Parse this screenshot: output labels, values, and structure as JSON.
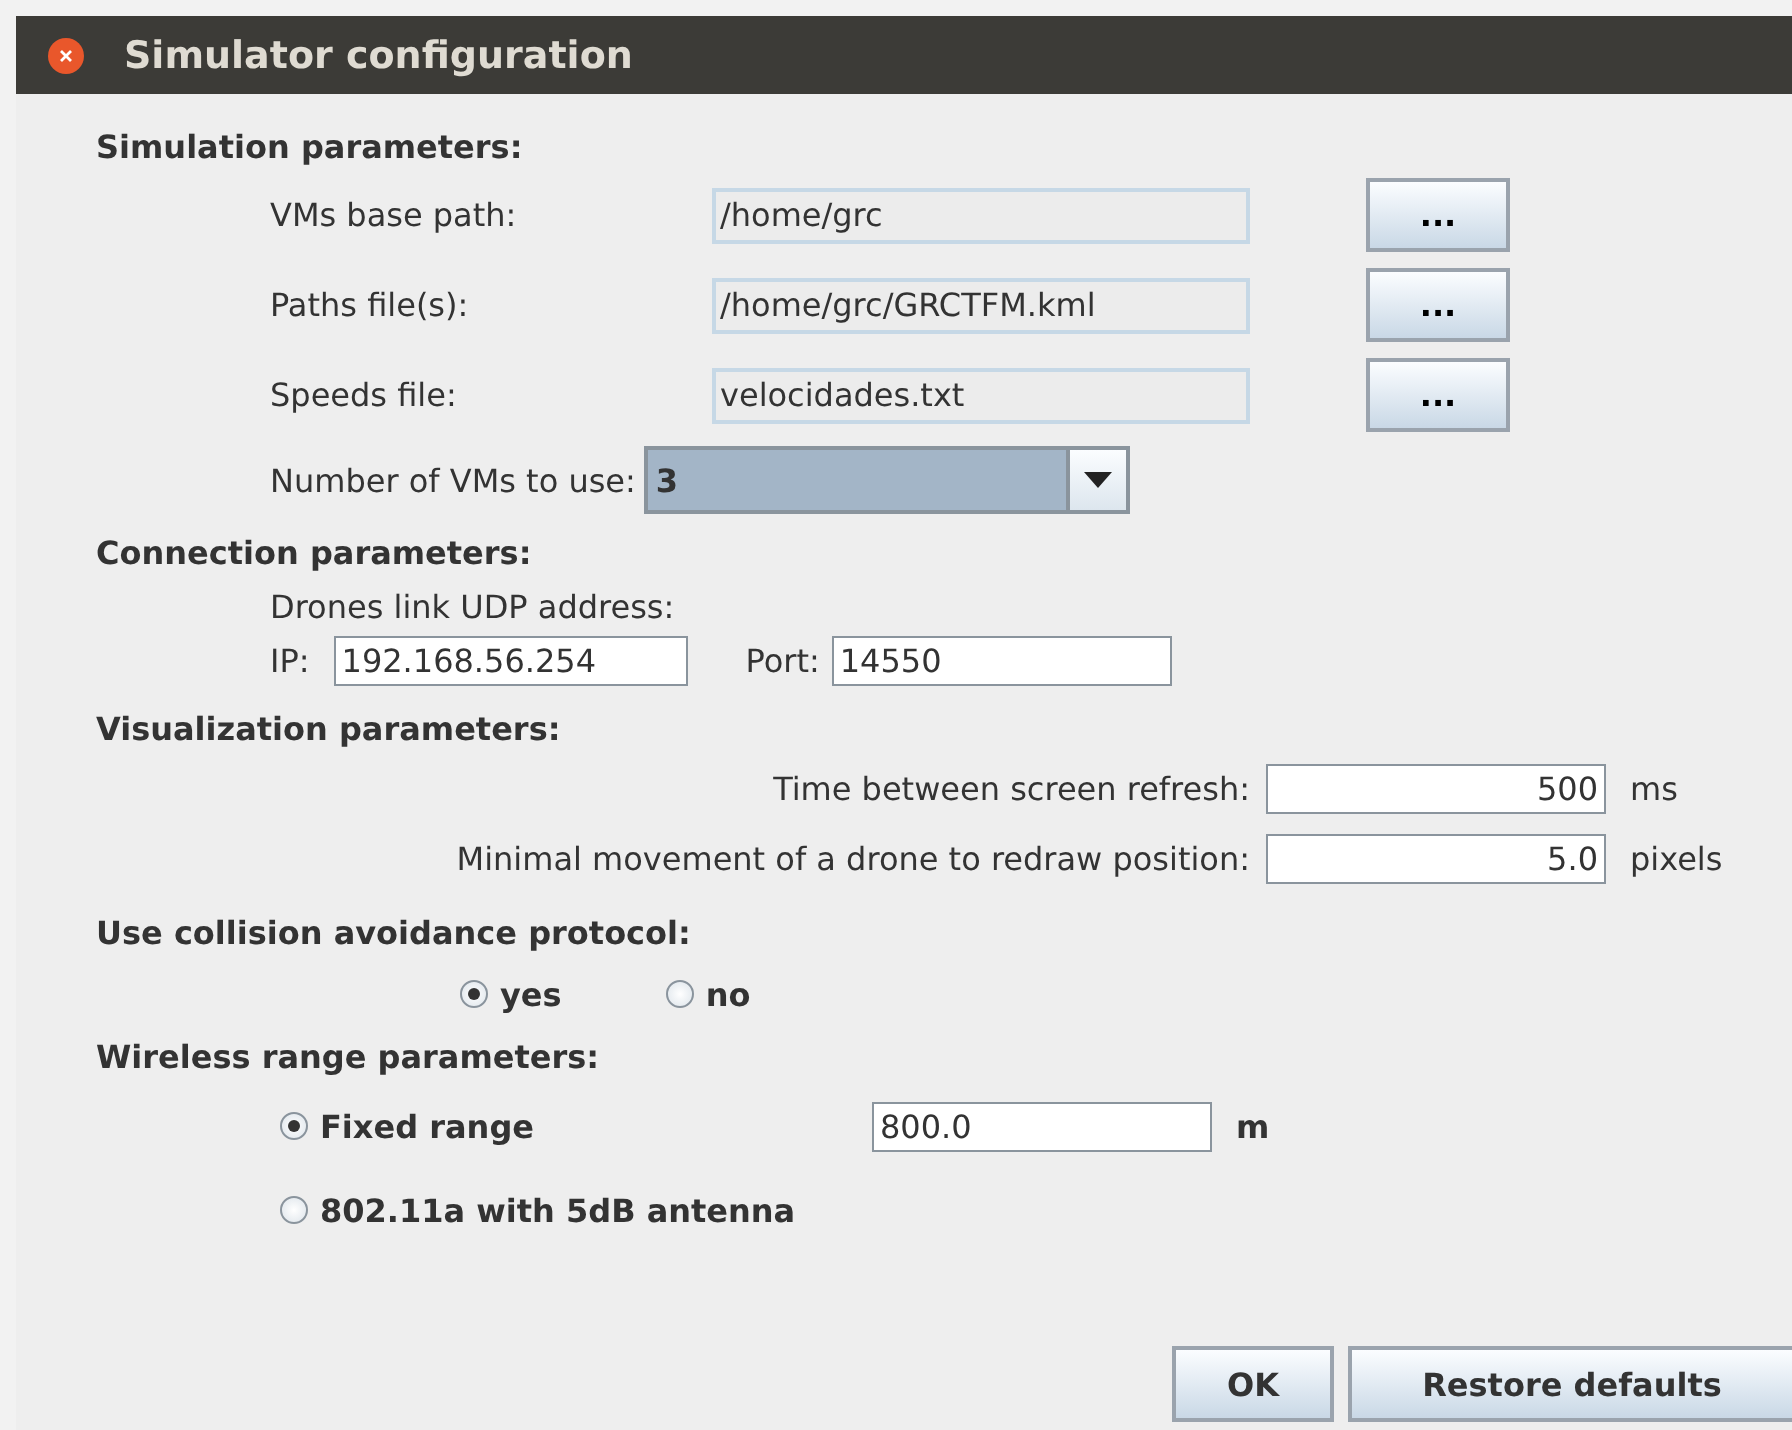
{
  "window": {
    "title": "Simulator configuration"
  },
  "simulation": {
    "heading": "Simulation parameters:",
    "files": [
      {
        "label": "VMs base path:",
        "value": "/home/grc",
        "button": "..."
      },
      {
        "label": "Paths file(s):",
        "value": "/home/grc/GRCTFM.kml",
        "button": "..."
      },
      {
        "label": "Speeds file:",
        "value": "velocidades.txt",
        "button": "..."
      }
    ],
    "vms": {
      "label": "Number of VMs to use:",
      "value": "3"
    }
  },
  "connection": {
    "heading": "Connection parameters:",
    "subheading": "Drones link UDP address:",
    "ip_label": "IP:",
    "ip": "192.168.56.254",
    "port_label": "Port:",
    "port": "14550"
  },
  "visualization": {
    "heading": "Visualization parameters:",
    "rows": [
      {
        "label": "Time between screen refresh:",
        "value": "500",
        "unit": "ms"
      },
      {
        "label": "Minimal movement of a drone to redraw position:",
        "value": "5.0",
        "unit": "pixels"
      }
    ]
  },
  "collision": {
    "heading": "Use collision avoidance protocol:",
    "options": [
      {
        "label": "yes",
        "selected": true
      },
      {
        "label": "no",
        "selected": false
      }
    ]
  },
  "wireless": {
    "heading": "Wireless range parameters:",
    "options": [
      {
        "label": "Fixed range",
        "selected": true,
        "value": "800.0",
        "unit": "m"
      },
      {
        "label": "802.11a with 5dB antenna",
        "selected": false
      }
    ]
  },
  "buttons": [
    "OK",
    "Restore defaults"
  ]
}
